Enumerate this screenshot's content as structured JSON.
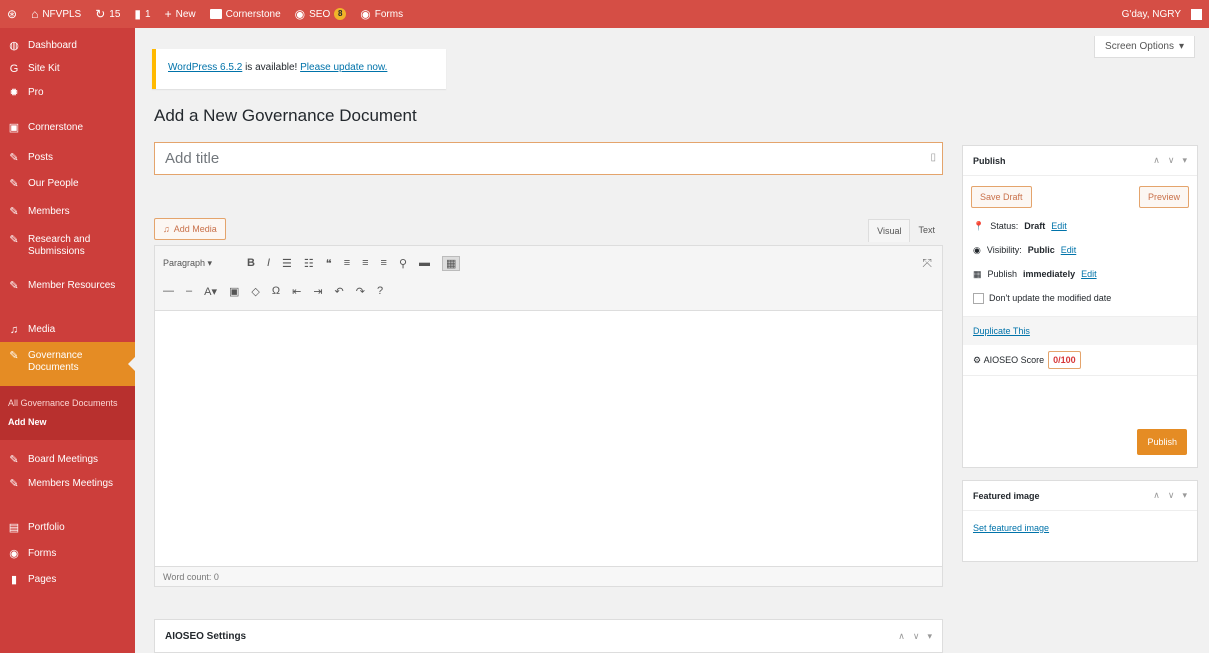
{
  "adminbar": {
    "site_name": "NFVPLS",
    "updates_count": "15",
    "comments_count": "1",
    "new_label": "New",
    "cornerstone_label": "Cornerstone",
    "seo_label": "SEO",
    "seo_badge": "8",
    "forms_label": "Forms",
    "greeting": "G'day, NGRY"
  },
  "sidebar": {
    "items": [
      {
        "label": "Dashboard",
        "icon": "dashboard-icon"
      },
      {
        "label": "Site Kit",
        "icon": "google-icon"
      },
      {
        "label": "Pro",
        "icon": "gear-icon"
      },
      {
        "label": "Cornerstone",
        "icon": "cornerstone-icon"
      },
      {
        "label": "Posts",
        "icon": "pin-icon"
      },
      {
        "label": "Our People",
        "icon": "pin-icon"
      },
      {
        "label": "Members",
        "icon": "pin-icon"
      },
      {
        "label": "Research and Submissions",
        "icon": "pin-icon"
      },
      {
        "label": "Member Resources",
        "icon": "pin-icon"
      },
      {
        "label": "Media",
        "icon": "media-icon"
      },
      {
        "label": "Governance Documents",
        "icon": "pin-icon"
      },
      {
        "label": "Board Meetings",
        "icon": "pin-icon"
      },
      {
        "label": "Members Meetings",
        "icon": "pin-icon"
      },
      {
        "label": "Portfolio",
        "icon": "portfolio-icon"
      },
      {
        "label": "Forms",
        "icon": "forms-icon"
      },
      {
        "label": "Pages",
        "icon": "pages-icon"
      }
    ],
    "submenu": [
      {
        "label": "All Governance Documents"
      },
      {
        "label": "Add New"
      }
    ]
  },
  "screen_options": "Screen Options",
  "notice": {
    "link1": "WordPress 6.5.2",
    "middle": " is available! ",
    "link2": "Please update now."
  },
  "page_title": "Add a New Governance Document",
  "title_placeholder": "Add title",
  "editor": {
    "add_media": "Add Media",
    "tab_visual": "Visual",
    "tab_text": "Text",
    "format_select": "Paragraph",
    "word_count": "Word count: 0"
  },
  "aioseo_settings": "AIOSEO Settings",
  "publish_box": {
    "title": "Publish",
    "save_draft": "Save Draft",
    "preview": "Preview",
    "status_label": "Status:",
    "status_value": "Draft",
    "visibility_label": "Visibility:",
    "visibility_value": "Public",
    "publish_label": "Publish",
    "publish_value": "immediately",
    "edit": "Edit",
    "dont_update": "Don't update the modified date",
    "duplicate": "Duplicate This",
    "aioseo_score_label": "AIOSEO Score",
    "aioseo_score": "0/100",
    "publish_button": "Publish"
  },
  "featured_box": {
    "title": "Featured image",
    "set_link": "Set featured image"
  },
  "colors": {
    "adminbar": "#d54e45",
    "sidebar": "#cc3e3b",
    "accent": "#e58c24"
  }
}
